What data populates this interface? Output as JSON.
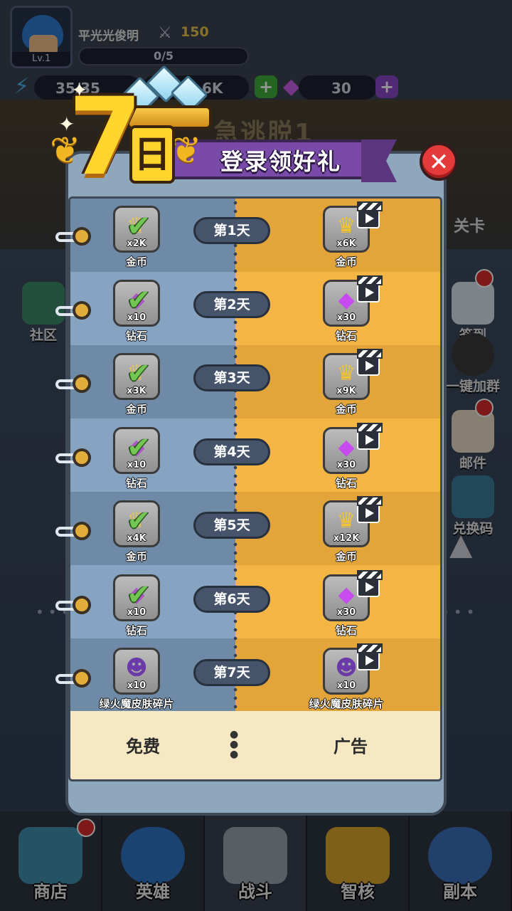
{
  "hud": {
    "player_name": "平光光俊明",
    "level": "Lv.1",
    "power": "150",
    "exp": "0/5",
    "energy": "35/35",
    "gold": "6K",
    "diamond": "30"
  },
  "background": {
    "title": "急逃脱1",
    "stage_label": "关卡",
    "side_buttons": [
      {
        "label": "社区",
        "icon": "community-icon"
      },
      {
        "label": "签到",
        "icon": "checkin-icon"
      },
      {
        "label": "一键加群",
        "icon": "qq-group-icon"
      },
      {
        "label": "邮件",
        "icon": "mail-icon"
      },
      {
        "label": "兑换码",
        "icon": "redeem-code-icon"
      }
    ]
  },
  "bottom_nav": [
    {
      "label": "商店",
      "icon": "shop-icon",
      "badge": true
    },
    {
      "label": "英雄",
      "icon": "hero-icon",
      "badge": false
    },
    {
      "label": "战斗",
      "icon": "battle-swords-icon",
      "badge": false
    },
    {
      "label": "智核",
      "icon": "core-icon",
      "badge": false
    },
    {
      "label": "副本",
      "icon": "globe-icon",
      "badge": false
    }
  ],
  "modal": {
    "badge_number": "7",
    "badge_day_char": "日",
    "title": "登录领好礼",
    "footer": {
      "free_label": "免费",
      "ad_label": "广告"
    },
    "days": [
      {
        "day_label": "第1天",
        "free": {
          "name": "金币",
          "qty": "x2K",
          "icon": "gold-coin-icon",
          "claimed": true
        },
        "ad": {
          "name": "金币",
          "qty": "x6K",
          "icon": "gold-coin-icon"
        }
      },
      {
        "day_label": "第2天",
        "free": {
          "name": "钻石",
          "qty": "x10",
          "icon": "diamond-icon",
          "claimed": true
        },
        "ad": {
          "name": "钻石",
          "qty": "x30",
          "icon": "diamond-icon"
        }
      },
      {
        "day_label": "第3天",
        "free": {
          "name": "金币",
          "qty": "x3K",
          "icon": "gold-coin-icon",
          "claimed": true
        },
        "ad": {
          "name": "金币",
          "qty": "x9K",
          "icon": "gold-coin-icon"
        }
      },
      {
        "day_label": "第4天",
        "free": {
          "name": "钻石",
          "qty": "x10",
          "icon": "diamond-icon",
          "claimed": true
        },
        "ad": {
          "name": "钻石",
          "qty": "x30",
          "icon": "diamond-icon"
        }
      },
      {
        "day_label": "第5天",
        "free": {
          "name": "金币",
          "qty": "x4K",
          "icon": "gold-coin-icon",
          "claimed": true
        },
        "ad": {
          "name": "金币",
          "qty": "x12K",
          "icon": "gold-coin-icon"
        }
      },
      {
        "day_label": "第6天",
        "free": {
          "name": "钻石",
          "qty": "x10",
          "icon": "diamond-icon",
          "claimed": true
        },
        "ad": {
          "name": "钻石",
          "qty": "x30",
          "icon": "diamond-icon"
        }
      },
      {
        "day_label": "第7天",
        "free": {
          "name": "绿火魔皮肤碎片",
          "qty": "x10",
          "icon": "green-fire-demon-skin-icon",
          "claimed": false
        },
        "ad": {
          "name": "绿火魔皮肤碎片",
          "qty": "x10",
          "icon": "green-fire-demon-skin-icon"
        }
      }
    ]
  },
  "colors": {
    "free_column_dark": "#6f8aa6",
    "free_column_light": "#86a3c2",
    "ad_column_dark": "#e3a43a",
    "ad_column_light": "#f4b545",
    "banner_purple": "#7a4aa8",
    "gold_yellow": "#ffd52e",
    "close_red": "#e43a3a"
  }
}
